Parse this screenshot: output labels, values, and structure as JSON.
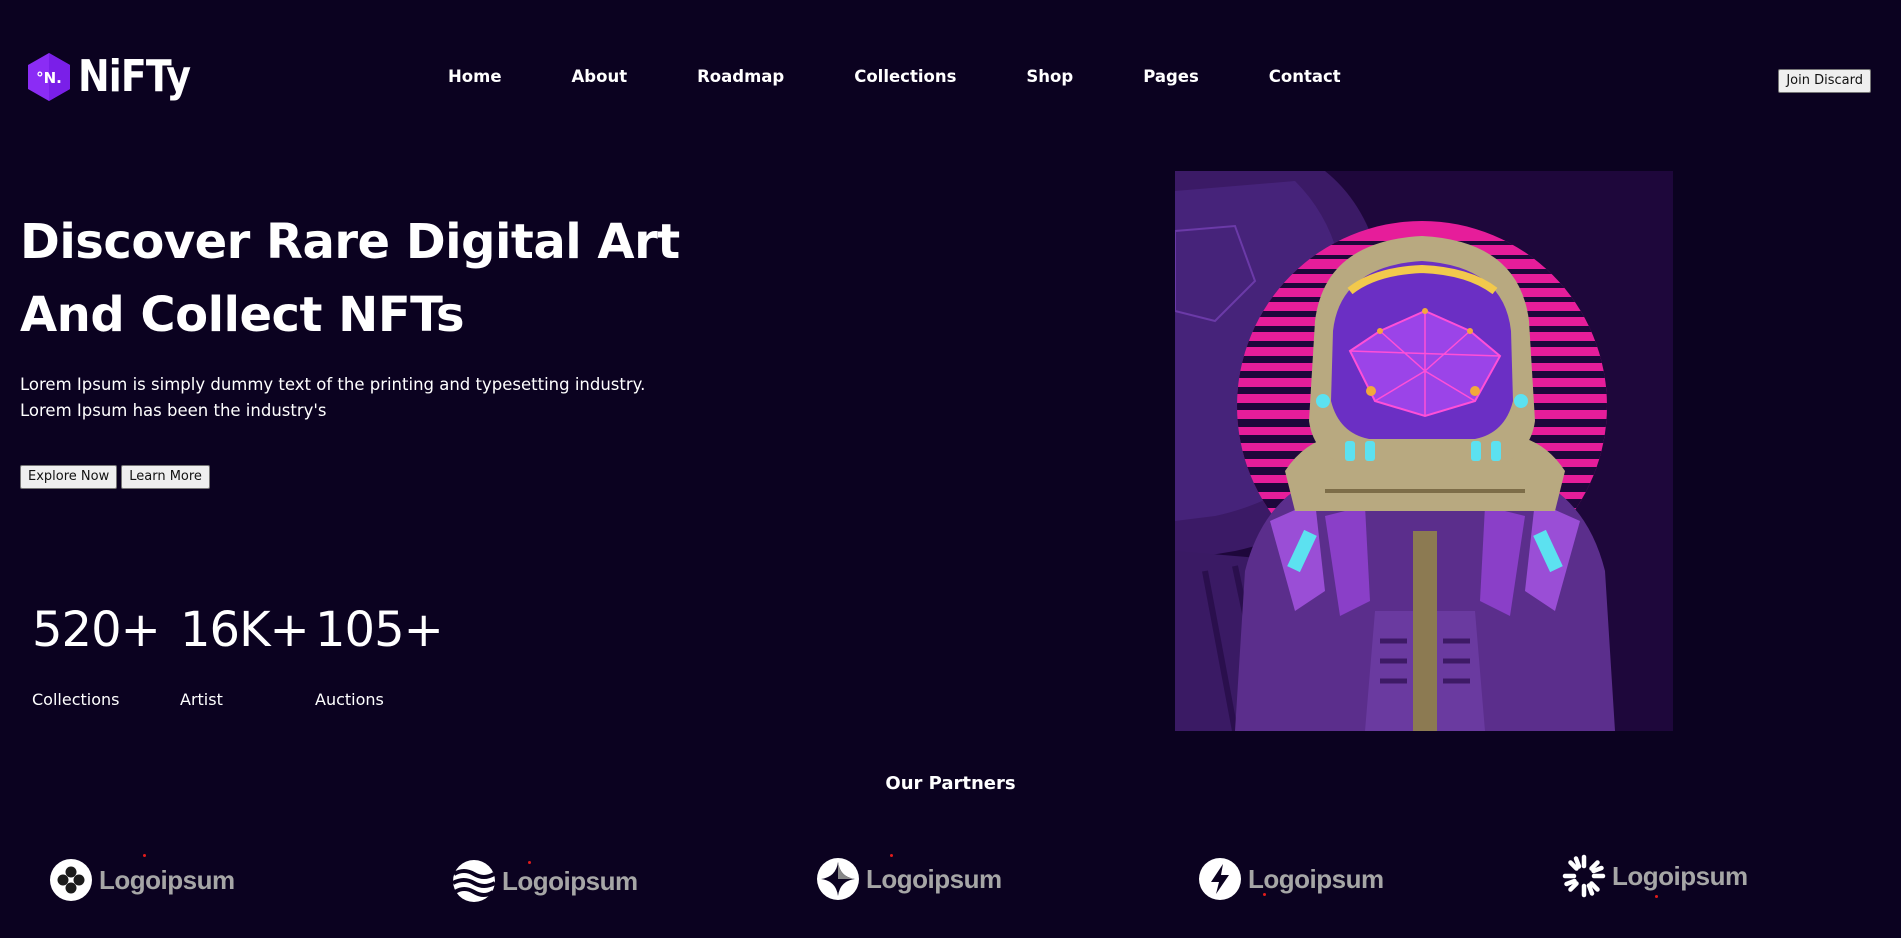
{
  "brand": {
    "mark_text": "°N.",
    "name": "NiFTy"
  },
  "nav": {
    "items": [
      "Home",
      "About",
      "Roadmap",
      "Collections",
      "Shop",
      "Pages",
      "Contact"
    ],
    "join_label": "Join Discard"
  },
  "hero": {
    "title_line1": "Discover Rare Digital Art",
    "title_line2": "And Collect NFTs",
    "desc_line1": "Lorem Ipsum is simply dummy text of the printing and typesetting industry.",
    "desc_line2": "Lorem Ipsum has been the industry's",
    "explore_label": "Explore Now",
    "learn_label": "Learn More"
  },
  "stats": [
    {
      "value": "520+",
      "label": "Collections"
    },
    {
      "value": "16K+",
      "label": "Artist"
    },
    {
      "value": "105+",
      "label": "Auctions"
    }
  ],
  "partners": {
    "title": "Our Partners",
    "logos": [
      {
        "name": "Logoipsum",
        "icon": "clover-icon"
      },
      {
        "name": "Logoipsum",
        "icon": "waves-icon"
      },
      {
        "name": "Logoipsum",
        "icon": "sparkle-icon"
      },
      {
        "name": "Logoipsum",
        "icon": "bolt-icon"
      },
      {
        "name": "Logoipsum",
        "icon": "sunburst-icon"
      }
    ]
  },
  "colors": {
    "background": "#0b0220",
    "accent": "#8b2cf5",
    "text": "#ffffff",
    "partner_text": "#a6a6a6"
  }
}
